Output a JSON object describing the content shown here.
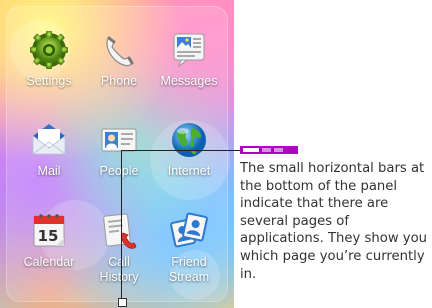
{
  "apps": [
    {
      "name": "Settings",
      "label": "Settings",
      "icon": "gear-icon"
    },
    {
      "name": "Phone",
      "label": "Phone",
      "icon": "phone-handset-icon"
    },
    {
      "name": "Messages",
      "label": "Messages",
      "icon": "messages-icon"
    },
    {
      "name": "Mail",
      "label": "Mail",
      "icon": "mail-envelope-icon"
    },
    {
      "name": "People",
      "label": "People",
      "icon": "contact-card-icon"
    },
    {
      "name": "Internet",
      "label": "Internet",
      "icon": "globe-icon"
    },
    {
      "name": "Calendar",
      "label": "Calendar",
      "icon": "calendar-icon",
      "day": "15"
    },
    {
      "name": "Call History",
      "label": "Call\nHistory",
      "icon": "call-history-icon"
    },
    {
      "name": "Friend Stream",
      "label": "Friend\nStream",
      "icon": "friend-stream-icon"
    }
  ],
  "page_indicator": {
    "pages": 3,
    "current": 1,
    "color": "#b000c8"
  },
  "annotation": {
    "text": "The small horizontal bars at the bottom of the panel indicate that there are several pages of applications. They show you which page you’re currently in."
  }
}
